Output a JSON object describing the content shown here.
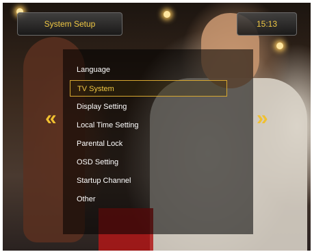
{
  "header": {
    "title": "System Setup",
    "clock": "15:13"
  },
  "menu": {
    "items": [
      {
        "label": "Language",
        "selected": false
      },
      {
        "label": "TV System",
        "selected": true
      },
      {
        "label": "Display Setting",
        "selected": false
      },
      {
        "label": "Local Time Setting",
        "selected": false
      },
      {
        "label": "Parental Lock",
        "selected": false
      },
      {
        "label": "OSD Setting",
        "selected": false
      },
      {
        "label": "Startup Channel",
        "selected": false
      },
      {
        "label": "Other",
        "selected": false
      }
    ]
  },
  "navigation": {
    "left_arrow_icon": "double-chevron-left-icon",
    "right_arrow_icon": "double-chevron-right-icon"
  },
  "colors": {
    "accent": "#f0c844",
    "menu_text": "#ffffff"
  }
}
